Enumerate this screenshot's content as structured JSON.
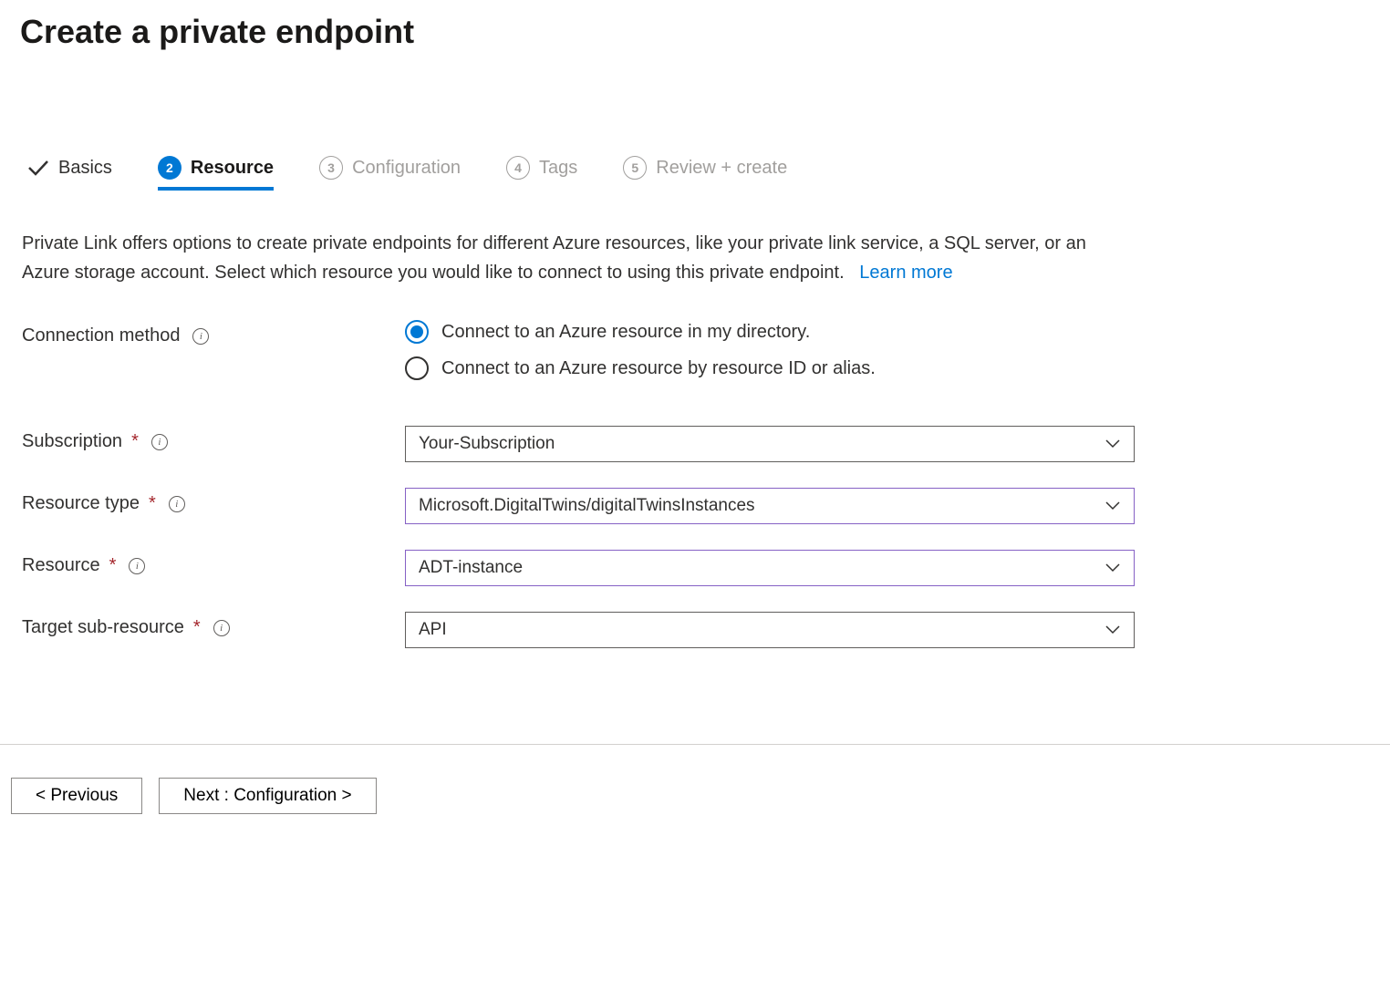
{
  "header": {
    "title": "Create a private endpoint"
  },
  "tabs": [
    {
      "label": "Basics",
      "state": "completed"
    },
    {
      "num": "2",
      "label": "Resource",
      "state": "active"
    },
    {
      "num": "3",
      "label": "Configuration",
      "state": "pending"
    },
    {
      "num": "4",
      "label": "Tags",
      "state": "pending"
    },
    {
      "num": "5",
      "label": "Review + create",
      "state": "pending"
    }
  ],
  "description": {
    "text": "Private Link offers options to create private endpoints for different Azure resources, like your private link service, a SQL server, or an Azure storage account. Select which resource you would like to connect to using this private endpoint.",
    "learn_more": "Learn more"
  },
  "form": {
    "connection_method": {
      "label": "Connection method",
      "options": [
        "Connect to an Azure resource in my directory.",
        "Connect to an Azure resource by resource ID or alias."
      ],
      "selected_index": 0
    },
    "subscription": {
      "label": "Subscription",
      "value": "Your-Subscription"
    },
    "resource_type": {
      "label": "Resource type",
      "value": "Microsoft.DigitalTwins/digitalTwinsInstances"
    },
    "resource": {
      "label": "Resource",
      "value": "ADT-instance"
    },
    "target_sub_resource": {
      "label": "Target sub-resource",
      "value": "API"
    }
  },
  "footer": {
    "previous": "< Previous",
    "next": "Next : Configuration >"
  }
}
